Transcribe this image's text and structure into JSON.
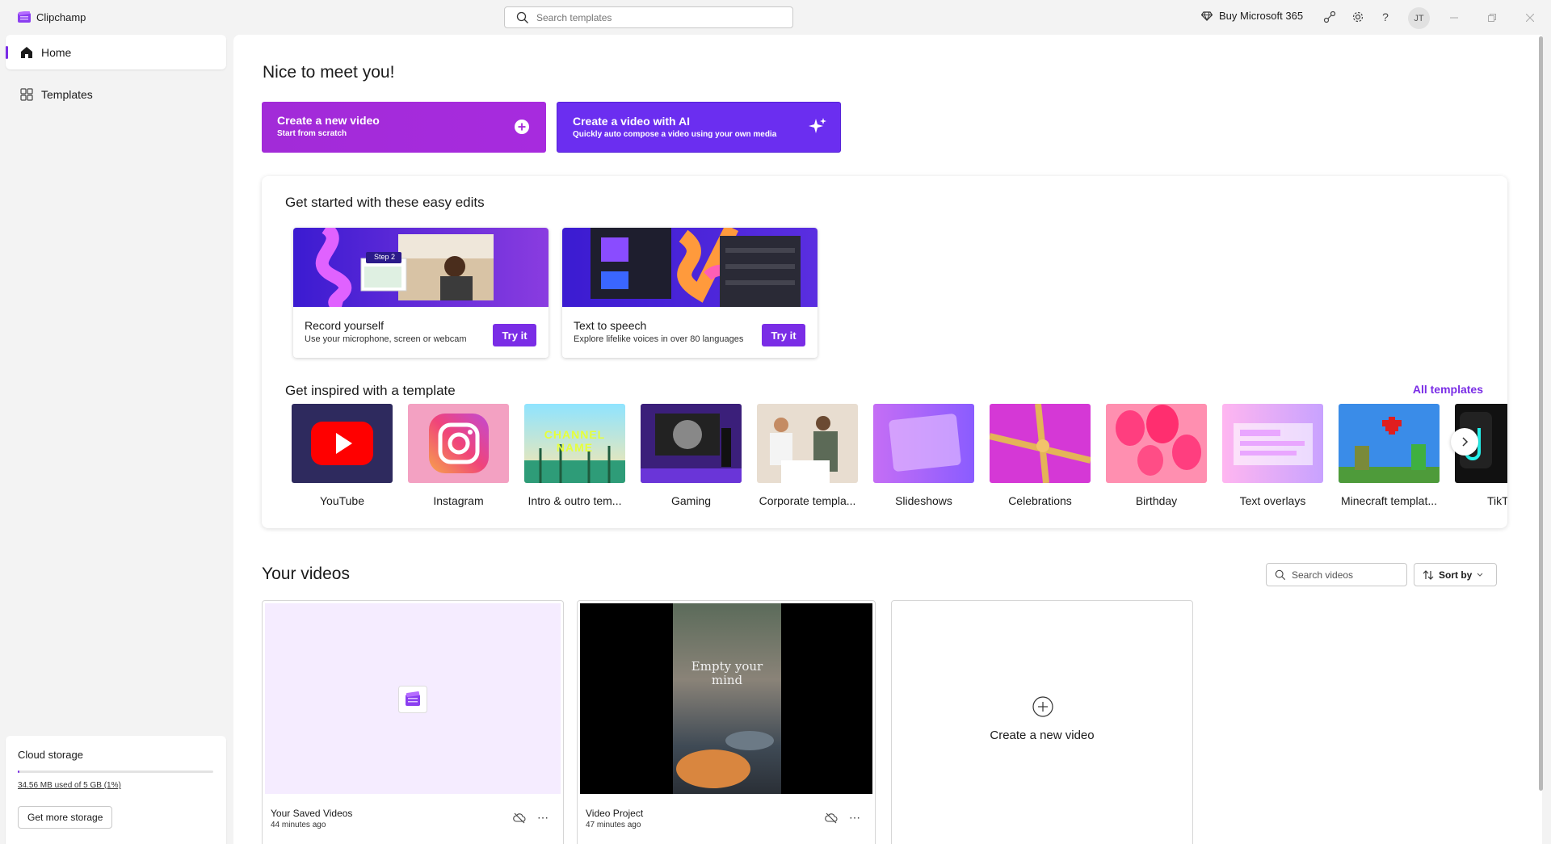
{
  "app": {
    "title": "Clipchamp"
  },
  "search": {
    "placeholder": "Search templates"
  },
  "titlebar": {
    "buy_label": "Buy Microsoft 365",
    "avatar_initials": "JT",
    "help_label": "?"
  },
  "sidebar": {
    "items": [
      {
        "label": "Home",
        "icon": "home-icon",
        "active": true
      },
      {
        "label": "Templates",
        "icon": "templates-icon",
        "active": false
      }
    ],
    "cloud": {
      "title": "Cloud storage",
      "usage": "34.56 MB used of 5 GB (1%)",
      "usage_fraction": 0.01,
      "button": "Get more storage"
    }
  },
  "main": {
    "greeting": "Nice to meet you!",
    "create_new": {
      "title": "Create a new video",
      "subtitle": "Start from scratch"
    },
    "create_ai": {
      "title": "Create a video with AI",
      "subtitle": "Quickly auto compose a video using your own media"
    },
    "easy_edits": {
      "heading": "Get started with these easy edits",
      "cards": [
        {
          "title": "Record yourself",
          "subtitle": "Use your microphone, screen or webcam",
          "button": "Try it",
          "overlay": "Step 2"
        },
        {
          "title": "Text to speech",
          "subtitle": "Explore lifelike voices in over 80 languages",
          "button": "Try it"
        }
      ]
    },
    "templates": {
      "heading": "Get inspired with a template",
      "all_link": "All templates",
      "items": [
        {
          "label": "YouTube"
        },
        {
          "label": "Instagram"
        },
        {
          "label": "Intro & outro tem...",
          "thumb_text": "CHANNEL NAME"
        },
        {
          "label": "Gaming"
        },
        {
          "label": "Corporate templa..."
        },
        {
          "label": "Slideshows"
        },
        {
          "label": "Celebrations"
        },
        {
          "label": "Birthday"
        },
        {
          "label": "Text overlays"
        },
        {
          "label": "Minecraft templat..."
        },
        {
          "label": "TikT"
        }
      ]
    },
    "videos": {
      "heading": "Your videos",
      "search_placeholder": "Search videos",
      "sort_label": "Sort by",
      "items": [
        {
          "title": "Your Saved Videos",
          "time": "44 minutes ago"
        },
        {
          "title": "Video Project",
          "time": "47 minutes ago",
          "overlay": "Empty your mind"
        }
      ],
      "new_card_label": "Create a new video"
    }
  },
  "colors": {
    "accent": "#7a2de6",
    "create_new": "#a62ad9",
    "create_ai": "#6b2ef0"
  }
}
